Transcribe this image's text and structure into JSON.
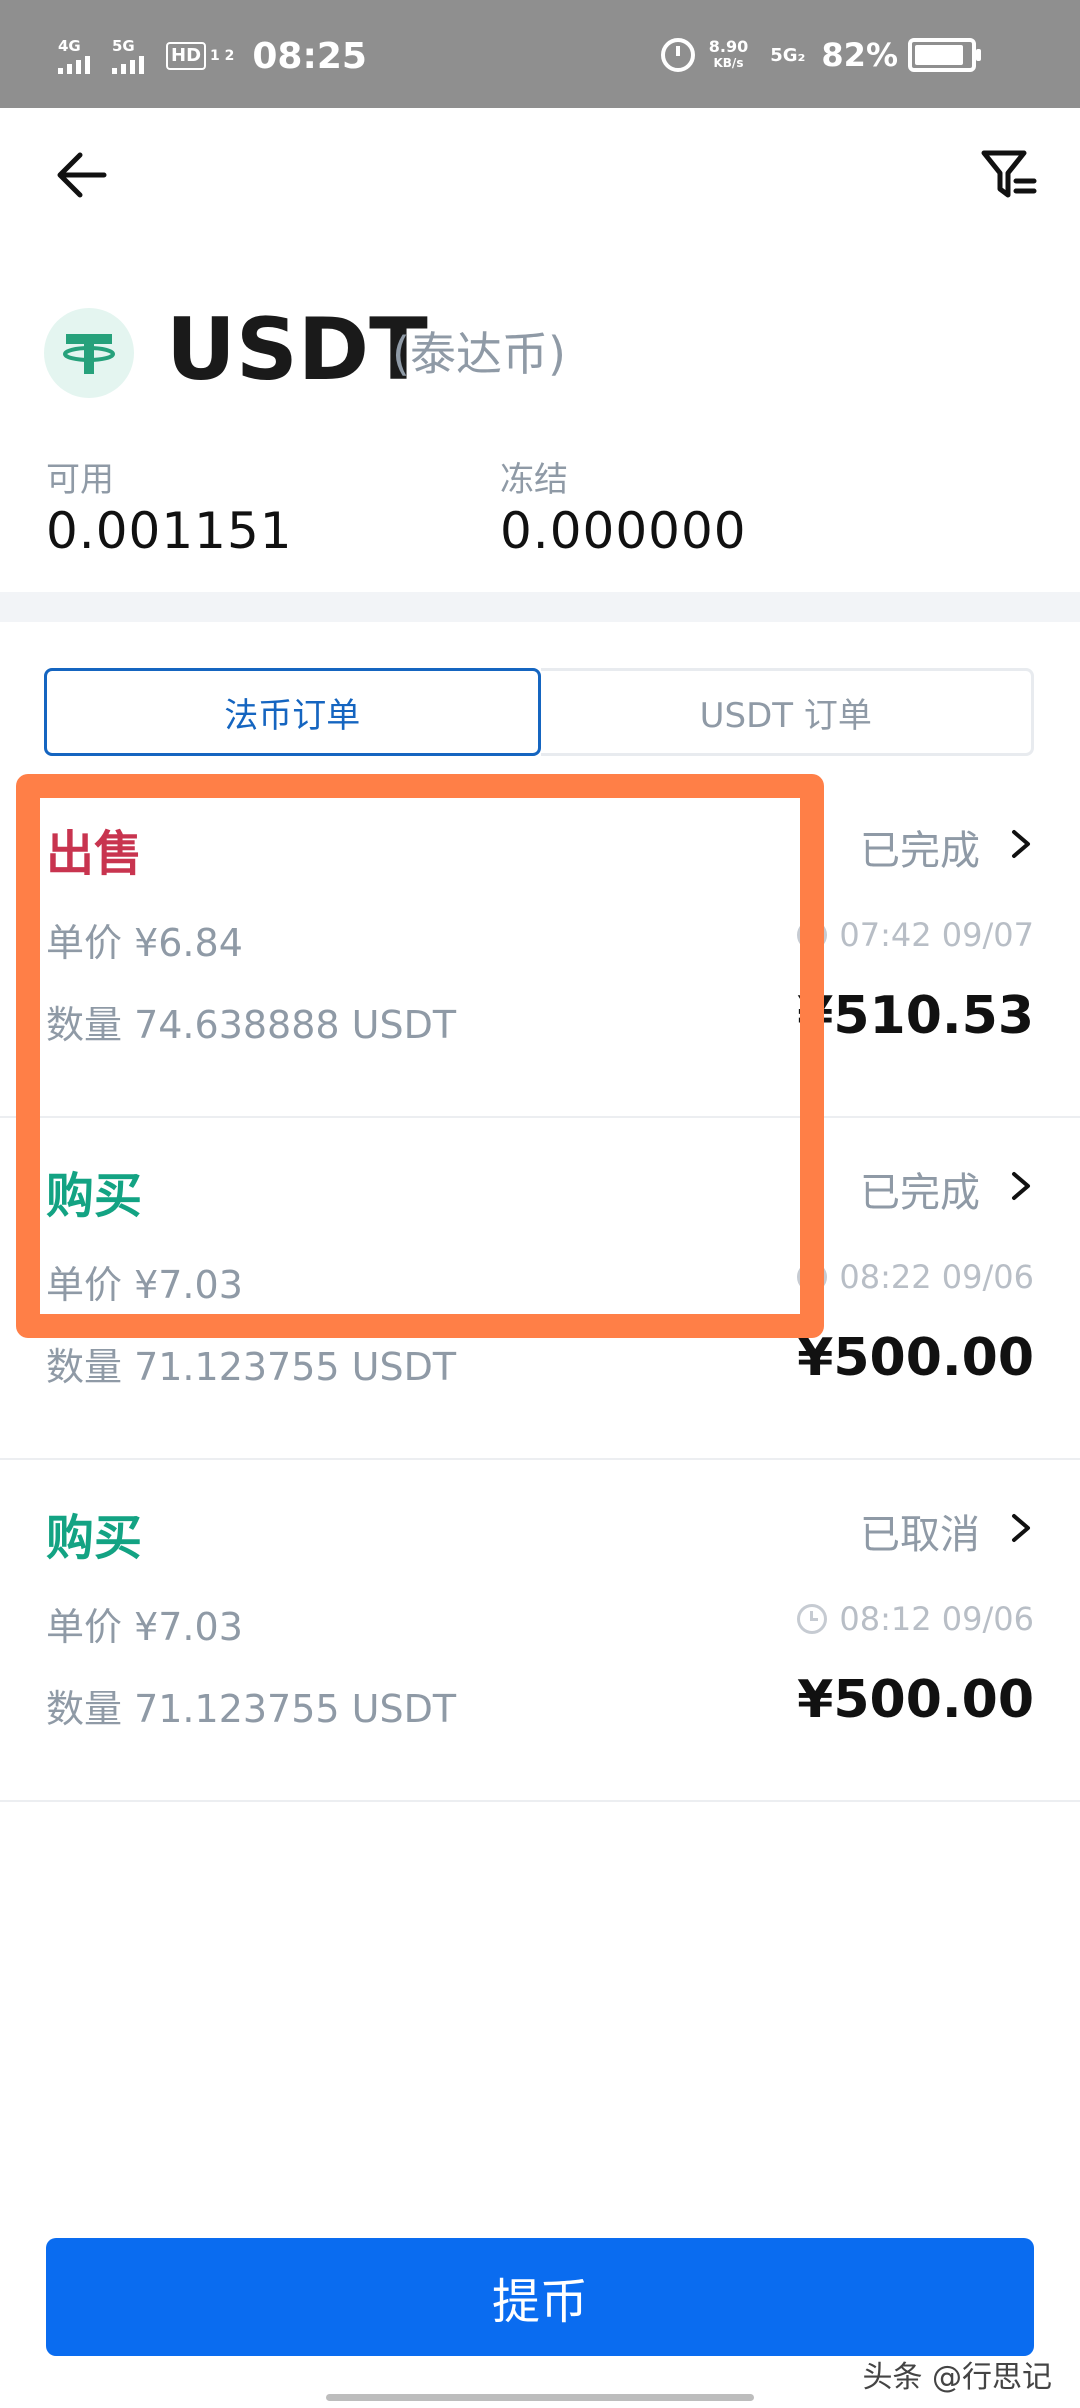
{
  "status_bar": {
    "network1": "4G",
    "network2": "5G",
    "hd": "HD",
    "hd_sub": "1 2",
    "time": "08:25",
    "speed_value": "8.90",
    "speed_unit": "KB/s",
    "network3": "5G₂",
    "battery": "82%"
  },
  "nav": {
    "back_icon": "back-arrow-icon",
    "filter_icon": "filter-icon"
  },
  "coin": {
    "symbol": "USDT",
    "name": "(泰达币)",
    "logo_color": "#26a17b",
    "available_label": "可用",
    "available_value": "0.001151",
    "frozen_label": "冻结",
    "frozen_value": "0.000000"
  },
  "tabs": [
    {
      "label": "法币订单",
      "active": true
    },
    {
      "label": "USDT 订单",
      "active": false
    }
  ],
  "orders": [
    {
      "type": "出售",
      "status": "已完成",
      "price": "单价 ¥6.84",
      "qty": "数量 74.638888 USDT",
      "time": "07:42 09/07",
      "amount": "¥510.53"
    },
    {
      "type": "购买",
      "status": "已完成",
      "price": "单价 ¥7.03",
      "qty": "数量 71.123755 USDT",
      "time": "08:22 09/06",
      "amount": "¥500.00"
    },
    {
      "type": "购买",
      "status": "已取消",
      "price": "单价 ¥7.03",
      "qty": "数量 71.123755 USDT",
      "time": "08:12 09/06",
      "amount": "¥500.00"
    }
  ],
  "colors": {
    "sell": "#c8344f",
    "buy": "#13a383",
    "primary": "#0a6cf0",
    "highlight": "#ff7f47"
  },
  "footer": {
    "withdraw_label": "提币",
    "watermark": "头条 @行思记"
  }
}
